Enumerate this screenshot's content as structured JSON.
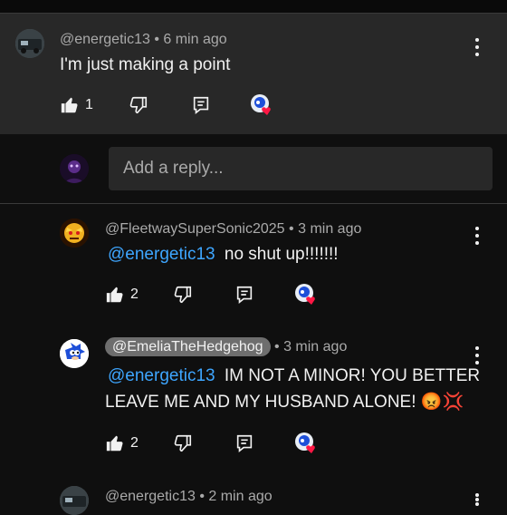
{
  "main_comment": {
    "handle": "@energetic13",
    "time": "6 min ago",
    "text": "I'm just making a point",
    "likes": "1"
  },
  "reply_box": {
    "placeholder": "Add a reply..."
  },
  "replies": [
    {
      "handle": "@FleetwaySuperSonic2025",
      "time": "3 min ago",
      "mention": "@energetic13",
      "text": "no shut up!!!!!!!",
      "likes": "2"
    },
    {
      "handle": "@EmeliaTheHedgehog",
      "time": "3 min ago",
      "mention": "@energetic13",
      "text_line1": "IM NOT A MINOR! YOU BETTER",
      "text_line2": "LEAVE ME AND MY HUSBAND ALONE! 😡💢",
      "likes": "2"
    },
    {
      "handle": "@energetic13",
      "time": "2 min ago"
    }
  ],
  "separator": "•",
  "colors": {
    "mention": "#3ea6ff",
    "heart": "#ff1744",
    "panel": "#282828"
  },
  "icons": [
    "thumb-up-icon",
    "thumb-down-icon",
    "reply-icon",
    "creator-heart-icon",
    "more-vert-icon"
  ]
}
